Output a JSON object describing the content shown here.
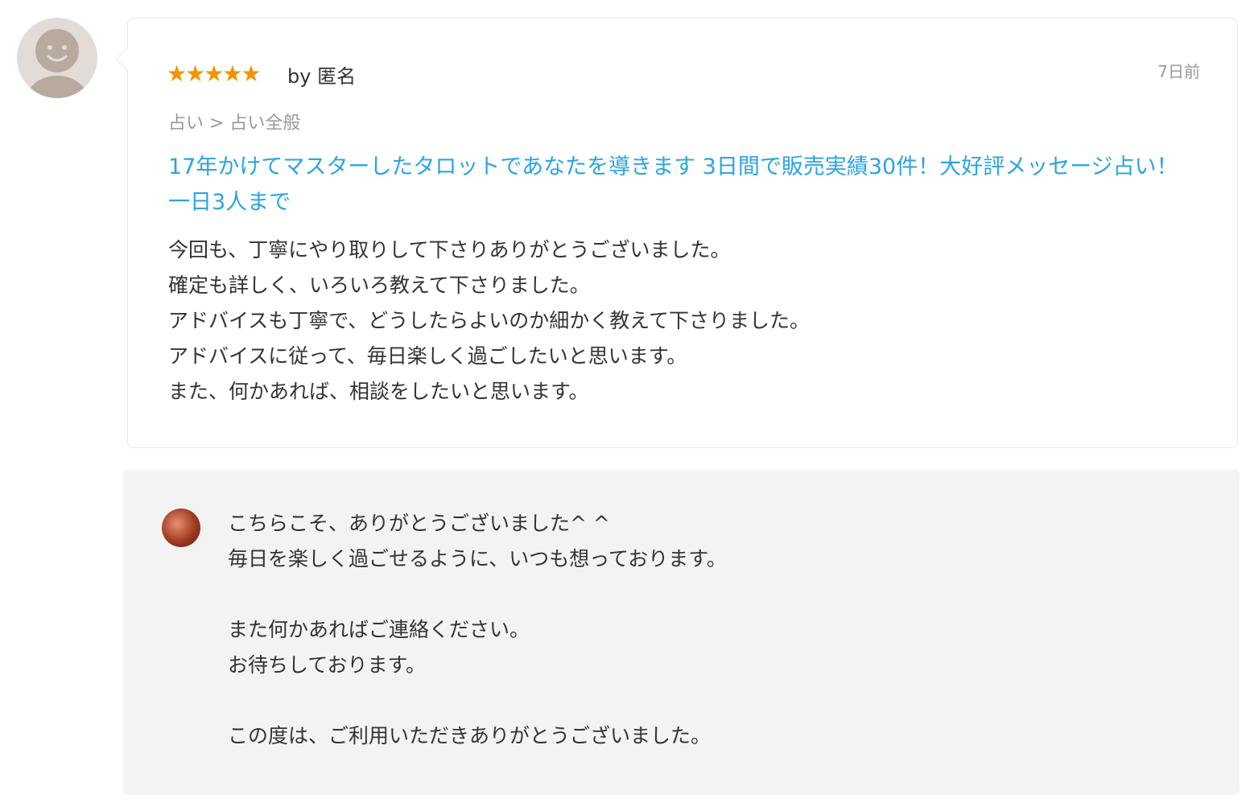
{
  "review": {
    "author_prefix": "by",
    "author_name": "匿名",
    "stars": "★★★★★",
    "rating": 5,
    "date": "7日前",
    "breadcrumb": "占い > 占い全般",
    "service_title": "17年かけてマスターしたタロットであなたを導きます 3日間で販売実績30件！大好評メッセージ占い！一日3人まで",
    "body": "今回も、丁寧にやり取りして下さりありがとうございました。\n確定も詳しく、いろいろ教えて下さりました。\nアドバイスも丁寧で、どうしたらよいのか細かく教えて下さりました。\nアドバイスに従って、毎日楽しく過ごしたいと思います。\nまた、何かあれば、相談をしたいと思います。"
  },
  "reply": {
    "body": "こちらこそ、ありがとうございました^ ^\n毎日を楽しく過ごせるように、いつも想っております。\n\nまた何かあればご連絡ください。\nお待ちしております。\n\nこの度は、ご利用いただきありがとうございました。"
  },
  "colors": {
    "star": "#f29400",
    "link": "#2aa4e0",
    "muted": "#999999",
    "reply_bg": "#f3f3f3"
  },
  "icons": {
    "reviewer_avatar": "default-user-icon",
    "reply_avatar": "seller-avatar"
  }
}
